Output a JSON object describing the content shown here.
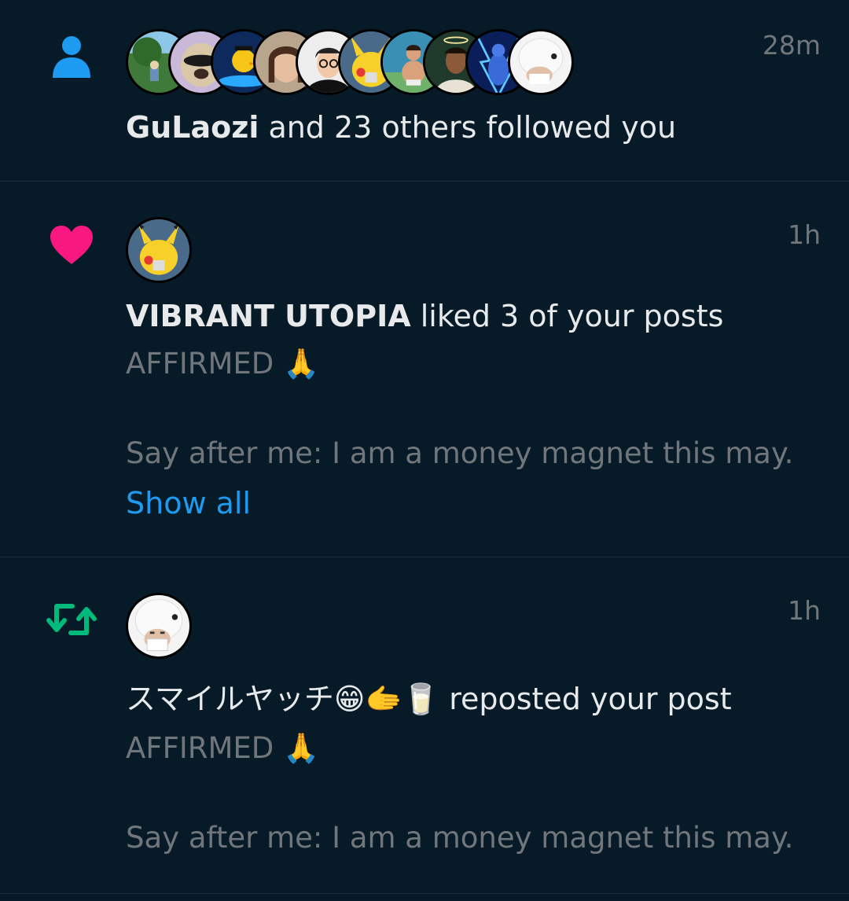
{
  "notifications": [
    {
      "type_icon": "person-icon",
      "time": "28m",
      "actor": "GuLaozi",
      "action": " and 23 others followed you",
      "avatar_count": 10
    },
    {
      "type_icon": "heart-icon",
      "time": "1h",
      "actor": "VIBRANT UTOPIA",
      "action": " liked 3 of your posts",
      "post_line1": "AFFIRMED 🙏",
      "post_line2": "Say after me: I am a money magnet this may.",
      "show_all": "Show all"
    },
    {
      "type_icon": "repost-icon",
      "time": "1h",
      "actor": "スマイルヤッチ😁🫱🥛",
      "action": " reposted your post",
      "post_line1": "AFFIRMED 🙏",
      "post_line2": "Say after me: I am a money magnet this may."
    }
  ],
  "colors": {
    "background": "#061a28",
    "follow_icon": "#1d9bf0",
    "like_icon": "#f91880",
    "repost_icon": "#00ba7c",
    "link": "#1d9bf0",
    "muted_text": "#71767b"
  }
}
